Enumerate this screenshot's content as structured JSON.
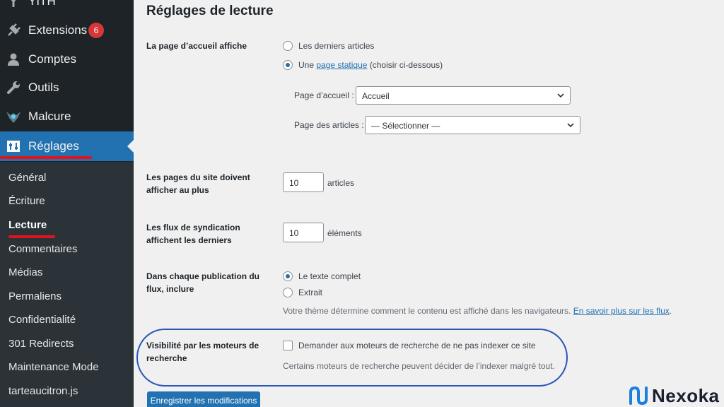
{
  "sidebar": {
    "menu": [
      {
        "label": "YITH",
        "icon": "yith-icon"
      },
      {
        "label": "Extensions",
        "icon": "plugin-icon",
        "badge": "6"
      },
      {
        "label": "Comptes",
        "icon": "users-icon"
      },
      {
        "label": "Outils",
        "icon": "wrench-icon"
      },
      {
        "label": "Malcure",
        "icon": "malcure-icon"
      },
      {
        "label": "Réglages",
        "icon": "settings-icon"
      }
    ],
    "submenu": [
      "Général",
      "Écriture",
      "Lecture",
      "Commentaires",
      "Médias",
      "Permaliens",
      "Confidentialité",
      "301 Redirects",
      "Maintenance Mode",
      "tarteaucitron.js"
    ],
    "current_submenu": "Lecture",
    "annotation_color": "#e3131b"
  },
  "main": {
    "title": "Réglages de lecture",
    "homepage": {
      "label": "La page d’accueil affiche",
      "option_latest": "Les derniers articles",
      "option_static_prefix": "Une",
      "option_static_link": "page statique",
      "option_static_suffix": "(choisir ci-dessous)",
      "selected": "static",
      "front_page_label": "Page d’accueil :",
      "front_page_value": "Accueil",
      "posts_page_label": "Page des articles :",
      "posts_page_value": "— Sélectionner —"
    },
    "posts_per_page": {
      "label": "Les pages du site doivent afficher au plus",
      "value": "10",
      "unit": "articles"
    },
    "feed_items": {
      "label": "Les flux de syndication affichent les derniers",
      "value": "10",
      "unit": "éléments"
    },
    "feed_content": {
      "label": "Dans chaque publication du flux, inclure",
      "option_full": "Le texte complet",
      "option_excerpt": "Extrait",
      "selected": "full",
      "description": "Votre thème détermine comment le contenu est affiché dans les navigateurs.",
      "description_link": "En savoir plus sur les flux",
      "description_end": "."
    },
    "search_visibility": {
      "label": "Visibilité par les moteurs de recherche",
      "checkbox_label": "Demander aux moteurs de recherche de ne pas indexer ce site",
      "checked": false,
      "description": "Certains moteurs de recherche peuvent décider de l’indexer malgré tout."
    },
    "save_button": "Enregistrer les modifications",
    "highlight_color": "#2a56b9"
  },
  "branding": {
    "logo_text": "Nexoka",
    "logo_color": "#1b7fe0"
  }
}
